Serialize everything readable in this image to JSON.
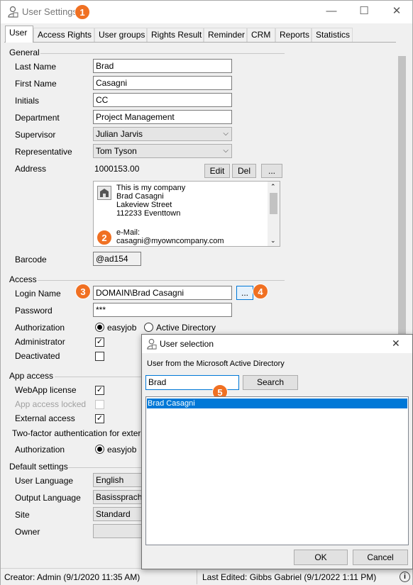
{
  "window": {
    "title": "User Settings",
    "minimize": "—",
    "maximize": "☐",
    "close": "✕"
  },
  "badges": [
    "1",
    "2",
    "3",
    "4",
    "5"
  ],
  "tabs": [
    "User",
    "Access Rights",
    "User groups",
    "Rights Result",
    "Reminder",
    "CRM",
    "Reports",
    "Statistics"
  ],
  "general": {
    "heading": "General",
    "last_name_label": "Last Name",
    "last_name": "Brad",
    "first_name_label": "First Name",
    "first_name": "Casagni",
    "initials_label": "Initials",
    "initials": "CC",
    "department_label": "Department",
    "department": "Project Management",
    "supervisor_label": "Supervisor",
    "supervisor": "Julian Jarvis",
    "representative_label": "Representative",
    "representative": "Tom Tyson",
    "address_label": "Address",
    "address_number": "1000153.00",
    "edit_label": "Edit",
    "del_label": "Del",
    "more_label": "...",
    "address_lines": [
      "This is my company",
      "Brad Casagni",
      "Lakeview Street",
      "112233 Eventtown",
      "",
      "e-Mail:",
      "casagni@myowncompany.com"
    ],
    "barcode_label": "Barcode",
    "barcode": "@ad154"
  },
  "access": {
    "heading": "Access",
    "login_label": "Login Name",
    "login": "DOMAIN\\Brad Casagni",
    "login_more": "...",
    "password_label": "Password",
    "password": "***",
    "authorization_label": "Authorization",
    "auth_easyjob": "easyjob",
    "auth_ad": "Active Directory",
    "administrator_label": "Administrator",
    "administrator_check": "✓",
    "deactivated_label": "Deactivated"
  },
  "app_access": {
    "heading": "App access",
    "webapp_label": "WebApp license",
    "webapp_check": "✓",
    "app_locked_label": "App access locked",
    "external_label": "External access",
    "external_check": "✓",
    "twofactor_label": "Two-factor authentication for external",
    "authorization_label": "Authorization",
    "auth_easyjob": "easyjob"
  },
  "defaults": {
    "heading": "Default settings",
    "user_language_label": "User Language",
    "user_language": "English",
    "output_language_label": "Output Language",
    "output_language": "Basissprache",
    "site_label": "Site",
    "site": "Standard",
    "owner_label": "Owner",
    "owner": ""
  },
  "status": {
    "creator": "Creator: Admin  (9/1/2020 11:35 AM)",
    "last_edited": "Last Edited:  Gibbs Gabriel (9/1/2022 1:11 PM)",
    "info_glyph": "i"
  },
  "dialog": {
    "title": "User selection",
    "close": "✕",
    "description": "User from the Microsoft Active Directory",
    "search_value": "Brad",
    "search_button": "Search",
    "results": [
      "Brad Casagni"
    ],
    "ok": "OK",
    "cancel": "Cancel"
  },
  "colors": {
    "badge": "#f07022",
    "selection": "#0078d7",
    "focus_border": "#0078d7"
  }
}
